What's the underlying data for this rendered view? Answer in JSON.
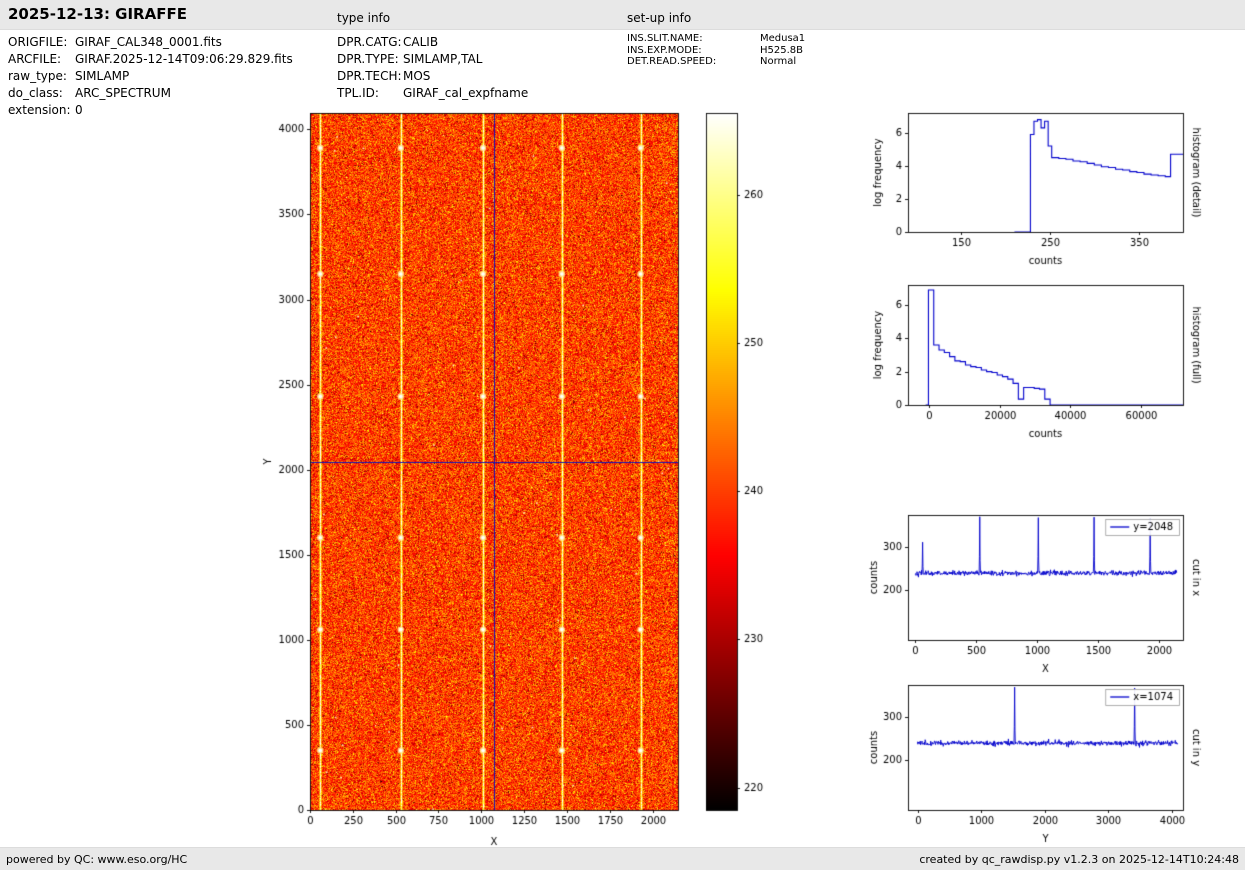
{
  "header": {
    "title": "2025-12-13: GIRAFFE",
    "type_info_label": "type info",
    "setup_info_label": "set-up info"
  },
  "metadata": {
    "left": [
      {
        "label": "ORIGFILE:",
        "value": "GIRAF_CAL348_0001.fits"
      },
      {
        "label": "ARCFILE:",
        "value": "GIRAF.2025-12-14T09:06:29.829.fits"
      },
      {
        "label": "raw_type:",
        "value": "SIMLAMP"
      },
      {
        "label": "do_class:",
        "value": "ARC_SPECTRUM"
      },
      {
        "label": "extension:",
        "value": "0"
      }
    ],
    "type_info": [
      {
        "label": "DPR.CATG:",
        "value": "CALIB"
      },
      {
        "label": "DPR.TYPE:",
        "value": "SIMLAMP,TAL"
      },
      {
        "label": "DPR.TECH:",
        "value": "MOS"
      },
      {
        "label": "TPL.ID:",
        "value": "GIRAF_cal_expfname"
      }
    ],
    "setup_info": [
      {
        "label": "INS.SLIT.NAME:",
        "value": "Medusa1"
      },
      {
        "label": "INS.EXP.MODE:",
        "value": "H525.8B"
      },
      {
        "label": "DET.READ.SPEED:",
        "value": "Normal"
      }
    ]
  },
  "footer": {
    "left": "powered by QC: www.eso.org/HC",
    "right": "created by qc_rawdisp.py v1.2.3 on 2025-12-14T10:24:48"
  },
  "chart_data": [
    {
      "id": "raw-image",
      "type": "heatmap",
      "xlabel": "X",
      "ylabel": "Y",
      "xlim": [
        0,
        2148
      ],
      "ylim": [
        0,
        4096
      ],
      "xticks": [
        0,
        250,
        500,
        750,
        1000,
        1250,
        1500,
        1750,
        2000
      ],
      "yticks": [
        0,
        500,
        1000,
        1500,
        2000,
        2500,
        3000,
        3500,
        4000
      ],
      "background_mean": 240,
      "background_sigma": 5,
      "emission_lines_x": [
        60,
        530,
        1010,
        1470,
        1930
      ],
      "bright_spots_y": [
        350,
        1060,
        1600,
        2430,
        3150,
        3890
      ],
      "crosshair": {
        "x": 1074,
        "y": 2048,
        "color": "#1414b8"
      },
      "colormap": "hot",
      "colorbar": {
        "range": [
          218.5,
          265.5
        ],
        "ticks": [
          220,
          230,
          240,
          250,
          260
        ]
      }
    },
    {
      "id": "histogram-detail",
      "type": "step",
      "xlabel": "counts",
      "ylabel": "log frequency",
      "right_label": "histogram (detail)",
      "xlim": [
        90,
        400
      ],
      "ylim": [
        0,
        7.2
      ],
      "xticks": [
        150,
        250,
        350
      ],
      "yticks": [
        0,
        2,
        4,
        6
      ],
      "line_color": "#0000cc",
      "steps": [
        [
          210,
          0
        ],
        [
          228,
          5.9
        ],
        [
          232,
          6.7
        ],
        [
          236,
          6.8
        ],
        [
          240,
          6.3
        ],
        [
          244,
          6.7
        ],
        [
          248,
          5.2
        ],
        [
          252,
          4.5
        ],
        [
          260,
          4.45
        ],
        [
          268,
          4.4
        ],
        [
          276,
          4.3
        ],
        [
          284,
          4.25
        ],
        [
          292,
          4.15
        ],
        [
          300,
          4.05
        ],
        [
          308,
          3.95
        ],
        [
          316,
          3.9
        ],
        [
          324,
          3.8
        ],
        [
          332,
          3.75
        ],
        [
          340,
          3.65
        ],
        [
          348,
          3.6
        ],
        [
          356,
          3.5
        ],
        [
          364,
          3.45
        ],
        [
          372,
          3.4
        ],
        [
          380,
          3.35
        ],
        [
          386,
          4.7
        ],
        [
          400,
          4.7
        ]
      ]
    },
    {
      "id": "histogram-full",
      "type": "step",
      "xlabel": "counts",
      "ylabel": "log frequency",
      "right_label": "histogram (full)",
      "xlim": [
        -6000,
        72000
      ],
      "ylim": [
        0,
        7.2
      ],
      "xticks": [
        0,
        20000,
        40000,
        60000
      ],
      "yticks": [
        0,
        2,
        4,
        6
      ],
      "line_color": "#0000cc",
      "steps": [
        [
          -1000,
          0
        ],
        [
          -200,
          6.9
        ],
        [
          1300,
          3.6
        ],
        [
          2800,
          3.3
        ],
        [
          4300,
          3.15
        ],
        [
          5800,
          2.9
        ],
        [
          7300,
          2.65
        ],
        [
          8800,
          2.6
        ],
        [
          10300,
          2.4
        ],
        [
          11800,
          2.3
        ],
        [
          13300,
          2.25
        ],
        [
          14800,
          2.1
        ],
        [
          16300,
          2.0
        ],
        [
          17800,
          1.95
        ],
        [
          19300,
          1.8
        ],
        [
          20800,
          1.7
        ],
        [
          22300,
          1.55
        ],
        [
          23800,
          1.3
        ],
        [
          25300,
          0.35
        ],
        [
          26800,
          1.05
        ],
        [
          29800,
          1.0
        ],
        [
          31300,
          0.95
        ],
        [
          32800,
          0.35
        ],
        [
          34300,
          0
        ],
        [
          72000,
          0
        ]
      ]
    },
    {
      "id": "cut-in-x",
      "type": "line",
      "xlabel": "X",
      "ylabel": "counts",
      "right_label": "cut in x",
      "legend": "y=2048",
      "xlim": [
        -60,
        2200
      ],
      "ylim": [
        85,
        375
      ],
      "xticks": [
        0,
        500,
        1000,
        1500,
        2000
      ],
      "yticks": [
        200,
        300
      ],
      "line_color": "#0000cc",
      "baseline": 240,
      "noise_sigma": 2.8,
      "domain": [
        0,
        2148
      ],
      "spikes": [
        {
          "x": 60,
          "peak": 312
        },
        {
          "x": 530,
          "peak": 371
        },
        {
          "x": 1010,
          "peak": 369
        },
        {
          "x": 1470,
          "peak": 370
        },
        {
          "x": 1930,
          "peak": 366
        }
      ]
    },
    {
      "id": "cut-in-y",
      "type": "line",
      "xlabel": "Y",
      "ylabel": "counts",
      "right_label": "cut in y",
      "legend": "x=1074",
      "xlim": [
        -150,
        4180
      ],
      "ylim": [
        85,
        375
      ],
      "xticks": [
        0,
        1000,
        2000,
        3000,
        4000
      ],
      "yticks": [
        200,
        300
      ],
      "line_color": "#0000cc",
      "baseline": 240,
      "noise_sigma": 2.8,
      "domain": [
        0,
        4096
      ],
      "spikes": [
        {
          "x": 1530,
          "peak": 370
        },
        {
          "x": 3420,
          "peak": 368
        }
      ]
    }
  ]
}
